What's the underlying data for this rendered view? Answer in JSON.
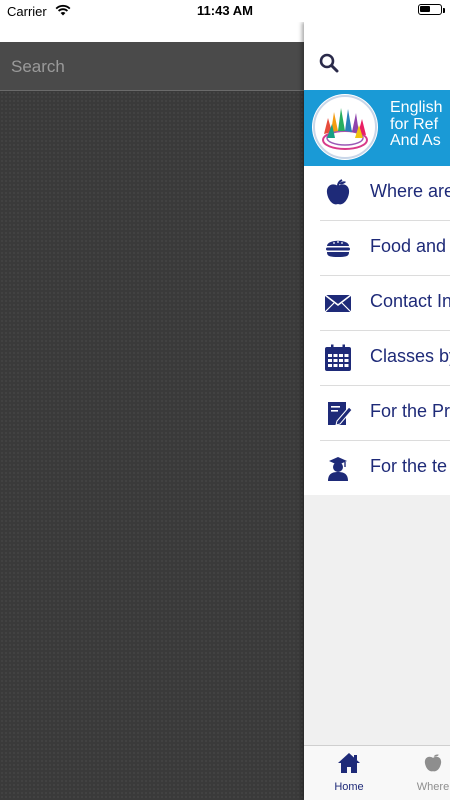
{
  "status_bar": {
    "carrier": "Carrier",
    "time": "11:43 AM"
  },
  "search": {
    "placeholder": "Search"
  },
  "banner": {
    "lines": [
      "English",
      "for Ref",
      "And As"
    ]
  },
  "menu": {
    "items": [
      {
        "label": "Where are",
        "icon": "apple-icon"
      },
      {
        "label": "Food and",
        "icon": "burger-icon"
      },
      {
        "label": "Contact In",
        "icon": "envelope-icon"
      },
      {
        "label": "Classes by",
        "icon": "calendar-icon"
      },
      {
        "label": "For the Pr",
        "icon": "document-edit-icon"
      },
      {
        "label": "For the te",
        "icon": "graduate-icon"
      }
    ]
  },
  "tabs": [
    {
      "label": "Home",
      "icon": "home-icon",
      "active": true
    },
    {
      "label": "Where",
      "icon": "apple-icon",
      "active": false
    }
  ],
  "colors": {
    "accent": "#1e2a78",
    "banner": "#1a9ad6",
    "dark_bg": "#3b3b3b"
  }
}
